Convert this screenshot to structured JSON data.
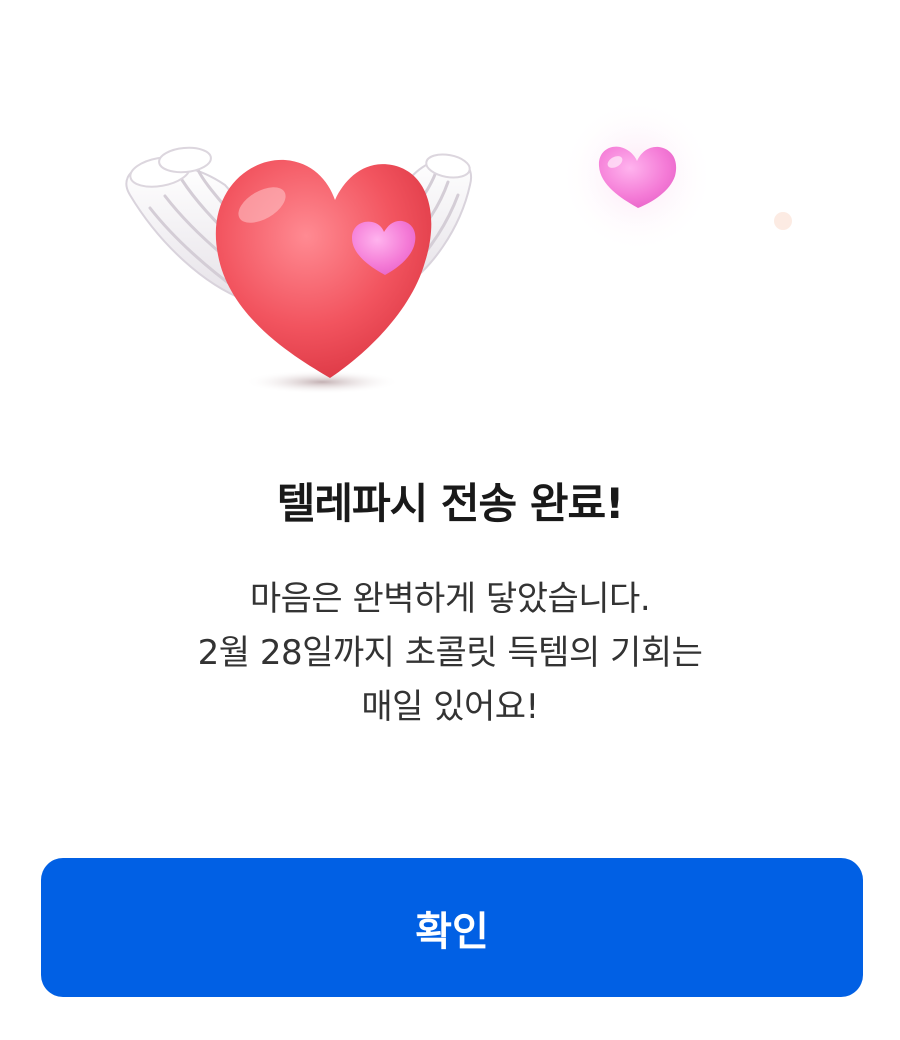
{
  "dialog": {
    "title": "텔레파시 전송 완료!",
    "message_lines": [
      "마음은 완벽하게 닿았습니다.",
      "2월 28일까지 초콜릿 득템의 기회는",
      "매일 있어요!"
    ],
    "confirm_label": "확인"
  },
  "illustration": {
    "main_icon": "winged-heart-icon",
    "secondary_icon": "small-heart-icon"
  },
  "colors": {
    "button": "#0160e4",
    "button_text": "#ffffff",
    "title": "#191919",
    "message": "#333333",
    "heart": "#f0505f",
    "small_heart": "#f27ad4"
  }
}
